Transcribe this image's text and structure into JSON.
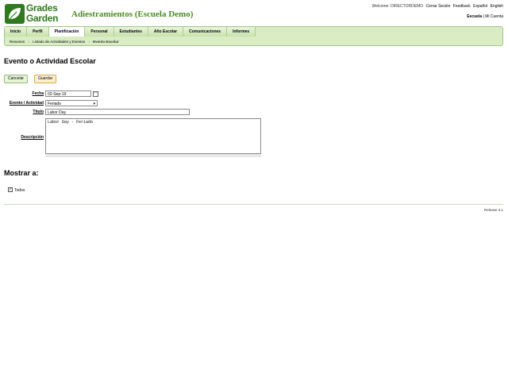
{
  "header": {
    "logo_line1": "Grades",
    "logo_line2": "Garden",
    "school_title": "Adiestramientos (Escuela Demo)",
    "welcome": "Welcome: DIRECTORDEMO",
    "logout": "Cerrar Sesión",
    "feedback": "Feedback",
    "lang_es": "Español",
    "lang_en": "English",
    "role_school": "Escuela",
    "role_sep": "|",
    "role_account": "Mi Cuenta"
  },
  "menu": {
    "items": [
      "Inicio",
      "Perfil",
      "Planificación",
      "Personal",
      "Estudiantes",
      "Año Escolar",
      "Comunicaciones",
      "Informes"
    ]
  },
  "breadcrumb": {
    "items": [
      "Resumen",
      "Listado de Actividades y Eventos",
      "Evento Escolar"
    ]
  },
  "page": {
    "title": "Evento o Actividad Escolar",
    "cancel": "Cancelar",
    "save": "Guardar"
  },
  "form": {
    "date_label": "Fecha",
    "date_value": "02-Sep-19",
    "type_label": "Evento / Actividad",
    "type_value": "Feriado",
    "title_label": "Título",
    "title_value": "Labor Day",
    "desc_label": "Descripción",
    "desc_value": "Labor Day - Feriado"
  },
  "show": {
    "title": "Mostrar a:",
    "all_label": "Todos"
  },
  "footer": {
    "release": "Release 3.1"
  }
}
